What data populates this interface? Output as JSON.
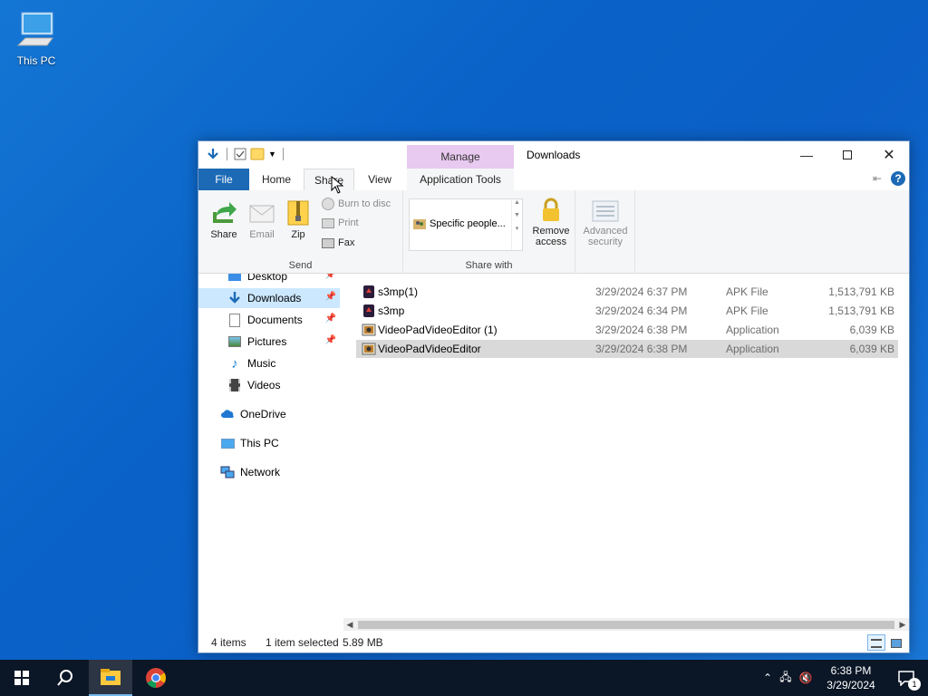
{
  "desktop": {
    "icons": [
      {
        "label": "This PC",
        "icon": "this-pc-icon"
      }
    ]
  },
  "window": {
    "title": "Downloads",
    "manage_label": "Manage",
    "tabs": {
      "file": "File",
      "home": "Home",
      "share": "Share",
      "view": "View",
      "application_tools": "Application Tools"
    },
    "ribbon": {
      "send_group": {
        "label": "Send",
        "share": "Share",
        "email": "Email",
        "zip": "Zip",
        "burn": "Burn to disc",
        "print": "Print",
        "fax": "Fax"
      },
      "share_with_group": {
        "label": "Share with",
        "list_item": "Specific people...",
        "remove_access": [
          "Remove",
          "access"
        ],
        "advanced_security": [
          "Advanced",
          "security"
        ]
      }
    },
    "nav": {
      "items": [
        {
          "label": "Desktop",
          "icon": "desktop-folder-icon",
          "pinned": true
        },
        {
          "label": "Downloads",
          "icon": "downloads-icon",
          "pinned": true,
          "selected": true
        },
        {
          "label": "Documents",
          "icon": "documents-icon",
          "pinned": true
        },
        {
          "label": "Pictures",
          "icon": "pictures-icon",
          "pinned": true
        },
        {
          "label": "Music",
          "icon": "music-icon"
        },
        {
          "label": "Videos",
          "icon": "videos-icon"
        },
        {
          "label": "OneDrive",
          "icon": "onedrive-icon"
        },
        {
          "label": "This PC",
          "icon": "this-pc-icon"
        },
        {
          "label": "Network",
          "icon": "network-icon"
        }
      ]
    },
    "files": [
      {
        "name": "s3mp(1)",
        "date": "3/29/2024 6:37 PM",
        "type": "APK File",
        "size": "1,513,791 KB",
        "icon": "apk-file-icon"
      },
      {
        "name": "s3mp",
        "date": "3/29/2024 6:34 PM",
        "type": "APK File",
        "size": "1,513,791 KB",
        "icon": "apk-file-icon"
      },
      {
        "name": "VideoPadVideoEditor (1)",
        "date": "3/29/2024 6:38 PM",
        "type": "Application",
        "size": "6,039 KB",
        "icon": "application-icon"
      },
      {
        "name": "VideoPadVideoEditor",
        "date": "3/29/2024 6:38 PM",
        "type": "Application",
        "size": "6,039 KB",
        "icon": "application-icon",
        "selected": true
      }
    ],
    "status": {
      "items_count": "4 items",
      "selected": "1 item selected",
      "size": "5.89 MB"
    }
  },
  "taskbar": {
    "time": "6:38 PM",
    "date": "3/29/2024",
    "notification_count": "1"
  }
}
